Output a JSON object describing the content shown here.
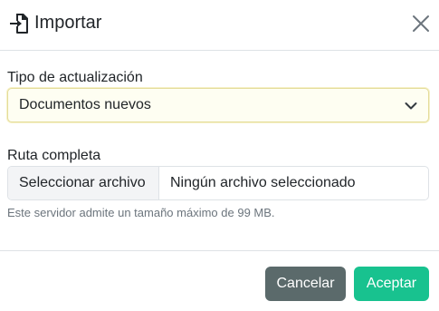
{
  "dialog": {
    "title": "Importar",
    "title_icon": "file-import-icon",
    "close_icon": "close-icon"
  },
  "update_type": {
    "label": "Tipo de actualización",
    "selected": "Documentos nuevos",
    "dropdown_icon": "chevron-down-icon"
  },
  "file_path": {
    "label": "Ruta completa",
    "button_label": "Seleccionar archivo",
    "status": "Ningún archivo seleccionado",
    "help": "Este servidor admite un tamaño máximo de 99 MB."
  },
  "footer": {
    "cancel_label": "Cancelar",
    "accept_label": "Aceptar"
  },
  "colors": {
    "cancel_bg": "#5b6a6b",
    "accept_bg": "#18c28f",
    "select_focus_bg": "#fefef2",
    "select_focus_border": "#e4dc9a"
  }
}
